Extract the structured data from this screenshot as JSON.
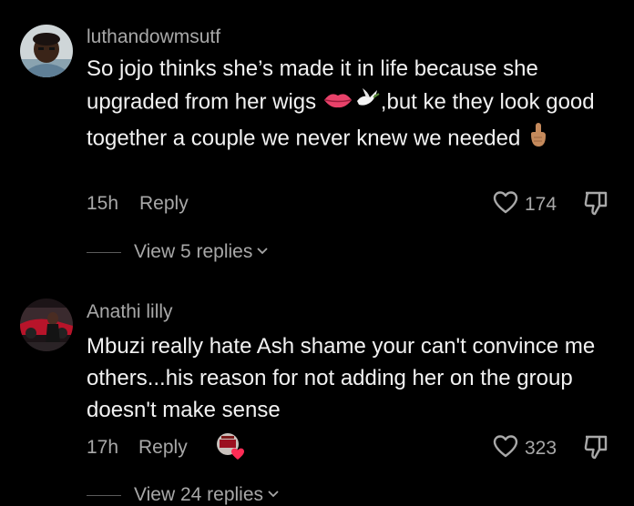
{
  "comments": [
    {
      "username": "luthandowmsutf",
      "text_before_emoji": "So jojo thinks she’s made it in life because she upgraded from her wigs ",
      "emoji_1": "lips-emoji",
      "emoji_2": "dove-emoji",
      "text_mid": ",but ke they look good together a couple we never knew we needed ",
      "emoji_3": "index-pointing-up-emoji",
      "time": "15h",
      "reply_label": "Reply",
      "likes": "174",
      "view_replies": "View 5 replies"
    },
    {
      "username": "Anathi lilly",
      "text": "Mbuzi really hate Ash shame your can't convince me others...his reason for not adding her on the group doesn't make sense",
      "time": "17h",
      "reply_label": "Reply",
      "likes": "323",
      "view_replies": "View 24 replies"
    }
  ],
  "colors": {
    "background": "#000000",
    "primary_text": "#f2f2f2",
    "secondary_text": "#a8a8a8",
    "creator_like_heart": "#fe2c55"
  },
  "icons": {
    "like": "heart-outline-icon",
    "dislike": "thumbs-down-icon",
    "expand": "chevron-down-icon"
  }
}
